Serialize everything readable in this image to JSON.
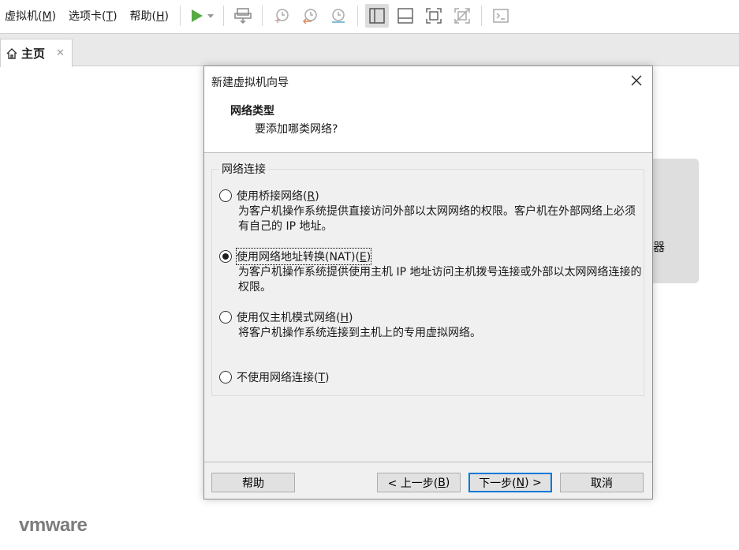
{
  "menubar": {
    "items": [
      {
        "text": "虚拟机(",
        "mnemonic": "M",
        "suffix": ")"
      },
      {
        "text": "选项卡(",
        "mnemonic": "T",
        "suffix": ")"
      },
      {
        "text": "帮助(",
        "mnemonic": "H",
        "suffix": ")"
      }
    ]
  },
  "toolbar": {
    "icons": [
      "play-icon",
      "dropdown-arrow-icon",
      "send-keys-icon",
      "snapshot-icon",
      "revert-snapshot-icon",
      "snapshot-manager-icon",
      "show-library-icon",
      "thumbnail-bar-icon",
      "fullscreen-icon",
      "unity-icon",
      "console-icon"
    ]
  },
  "tabs": {
    "home_label": "主页",
    "close_glyph": "✕"
  },
  "background": {
    "card_text": "器",
    "logo_text": "vmware"
  },
  "dialog": {
    "title": "新建虚拟机向导",
    "heading": "网络类型",
    "subheading": "要添加哪类网络?",
    "group_label": "网络连接",
    "options": [
      {
        "text": "使用桥接网络(",
        "mnemonic": "R",
        "suffix": ")",
        "description": "为客户机操作系统提供直接访问外部以太网网络的权限。客户机在外部网络上必须有自己的 IP 地址。",
        "selected": false
      },
      {
        "text": "使用网络地址转换(NAT)(",
        "mnemonic": "E",
        "suffix": ")",
        "description": "为客户机操作系统提供使用主机 IP 地址访问主机拨号连接或外部以太网网络连接的权限。",
        "selected": true
      },
      {
        "text": "使用仅主机模式网络(",
        "mnemonic": "H",
        "suffix": ")",
        "description": "将客户机操作系统连接到主机上的专用虚拟网络。",
        "selected": false
      },
      {
        "text": "不使用网络连接(",
        "mnemonic": "T",
        "suffix": ")",
        "description": "",
        "selected": false
      }
    ],
    "buttons": {
      "help": "帮助",
      "back_prefix": "< 上一步(",
      "back_mnemonic": "B",
      "back_suffix": ")",
      "next_prefix": "下一步(",
      "next_mnemonic": "N",
      "next_suffix": ") >",
      "cancel": "取消"
    }
  }
}
